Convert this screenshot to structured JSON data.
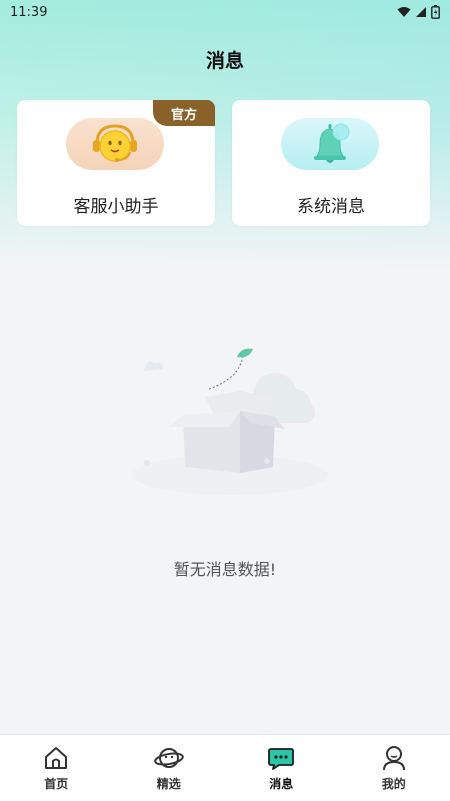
{
  "status_bar": {
    "time": "11:39",
    "icons": [
      "wifi-icon",
      "signal-icon",
      "battery-icon"
    ]
  },
  "header": {
    "title": "消息"
  },
  "cards": [
    {
      "label": "客服小助手",
      "badge": "官方",
      "icon": "customer-service-icon"
    },
    {
      "label": "系统消息",
      "icon": "bell-icon"
    }
  ],
  "empty_state": {
    "text": "暂无消息数据!",
    "icon": "empty-box-icon"
  },
  "tabbar": {
    "items": [
      {
        "label": "首页",
        "icon": "home-icon",
        "active": false
      },
      {
        "label": "精选",
        "icon": "planet-icon",
        "active": false
      },
      {
        "label": "消息",
        "icon": "chat-icon",
        "active": true
      },
      {
        "label": "我的",
        "icon": "user-icon",
        "active": false
      }
    ]
  },
  "colors": {
    "accent": "#2bc6a6",
    "badge": "#8a6128",
    "background": "#f3f4f6"
  }
}
